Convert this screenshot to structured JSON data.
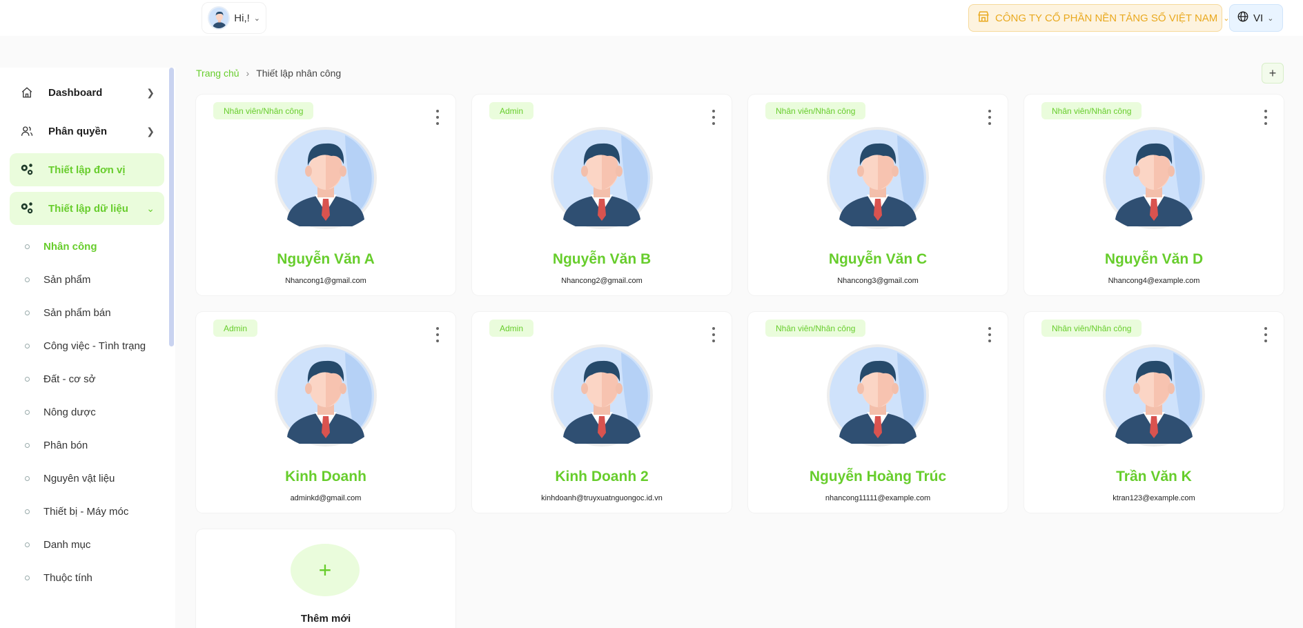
{
  "header": {
    "greeting": "Hi,!",
    "company": "CÔNG TY CỔ PHẦN NỀN TẢNG SỐ VIỆT NAM",
    "language": "VI"
  },
  "sidebar": {
    "items": [
      {
        "label": "Dashboard",
        "icon": "home-icon"
      },
      {
        "label": "Phân quyền",
        "icon": "users-icon"
      },
      {
        "label": "Thiết lập đơn vị",
        "icon": "gears-icon"
      },
      {
        "label": "Thiết lập dữ liệu",
        "icon": "gears-icon"
      }
    ],
    "sub_items": [
      "Nhân công",
      "Sản phẩm",
      "Sản phẩm bán",
      "Công việc - Tình trạng",
      "Đất - cơ sở",
      "Nông dược",
      "Phân bón",
      "Nguyên vật liệu",
      "Thiết bị - Máy móc",
      "Danh mục",
      "Thuộc tính"
    ]
  },
  "breadcrumb": {
    "home": "Trang chủ",
    "current": "Thiết lập nhân công"
  },
  "add_button": "+",
  "cards": [
    {
      "role": "Nhân viên/Nhân công",
      "name": "Nguyễn Văn A",
      "email": "Nhancong1@gmail.com"
    },
    {
      "role": "Admin",
      "name": "Nguyễn Văn B",
      "email": "Nhancong2@gmail.com"
    },
    {
      "role": "Nhân viên/Nhân công",
      "name": "Nguyễn Văn C",
      "email": "Nhancong3@gmail.com"
    },
    {
      "role": "Nhân viên/Nhân công",
      "name": "Nguyễn Văn D",
      "email": "Nhancong4@example.com"
    },
    {
      "role": "Admin",
      "name": "Kinh Doanh",
      "email": "adminkd@gmail.com"
    },
    {
      "role": "Admin",
      "name": "Kinh Doanh 2",
      "email": "kinhdoanh@truyxuatnguongoc.id.vn"
    },
    {
      "role": "Nhân viên/Nhân công",
      "name": "Nguyễn Hoàng Trúc",
      "email": "nhancong11111@example.com"
    },
    {
      "role": "Nhân viên/Nhân công",
      "name": "Trần Văn K",
      "email": "ktran123@example.com"
    }
  ],
  "add_card": {
    "plus": "+",
    "label": "Thêm mới"
  },
  "colors": {
    "accent": "#67cd2c",
    "accent_bg": "#eafcdc",
    "company_text": "#e9a91f"
  }
}
